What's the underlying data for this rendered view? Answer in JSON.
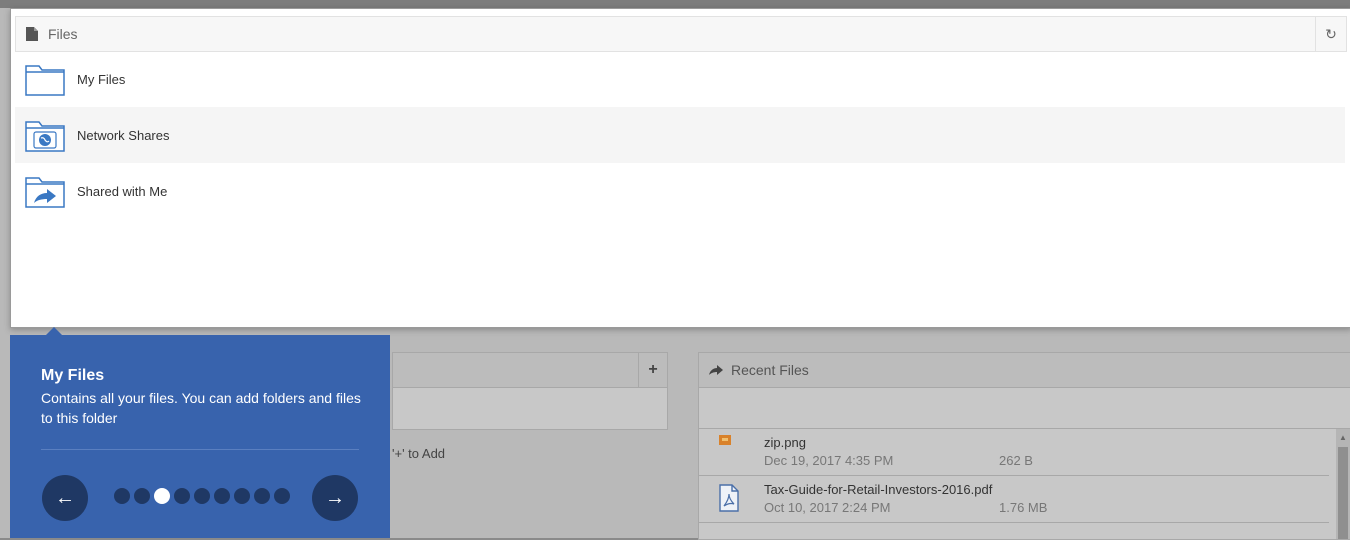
{
  "files_panel": {
    "title": "Files",
    "refresh_icon": "refresh-icon",
    "folders": [
      {
        "label": "My Files",
        "icon": "folder-icon"
      },
      {
        "label": "Network Shares",
        "icon": "network-folder-icon"
      },
      {
        "label": "Shared with Me",
        "icon": "shared-folder-icon"
      }
    ]
  },
  "background": {
    "left_panel_add_label": "+",
    "left_hint": "'+' to Add",
    "recent": {
      "title": "Recent Files",
      "items": [
        {
          "name": "zip.png",
          "date": "Dec 19, 2017 4:35 PM",
          "size": "262 B"
        },
        {
          "name": "Tax-Guide-for-Retail-Investors-2016.pdf",
          "date": "Oct 10, 2017 2:24 PM",
          "size": "1.76 MB"
        }
      ]
    }
  },
  "tour": {
    "title": "My Files",
    "body": "Contains all your files. You can add folders and files to this folder",
    "prev_label": "←",
    "next_label": "→",
    "step_count": 9,
    "active_step": 3
  },
  "colors": {
    "tour_bg": "#3863ad",
    "tour_button": "#1f3864",
    "folder_blue": "#3a78c3"
  }
}
